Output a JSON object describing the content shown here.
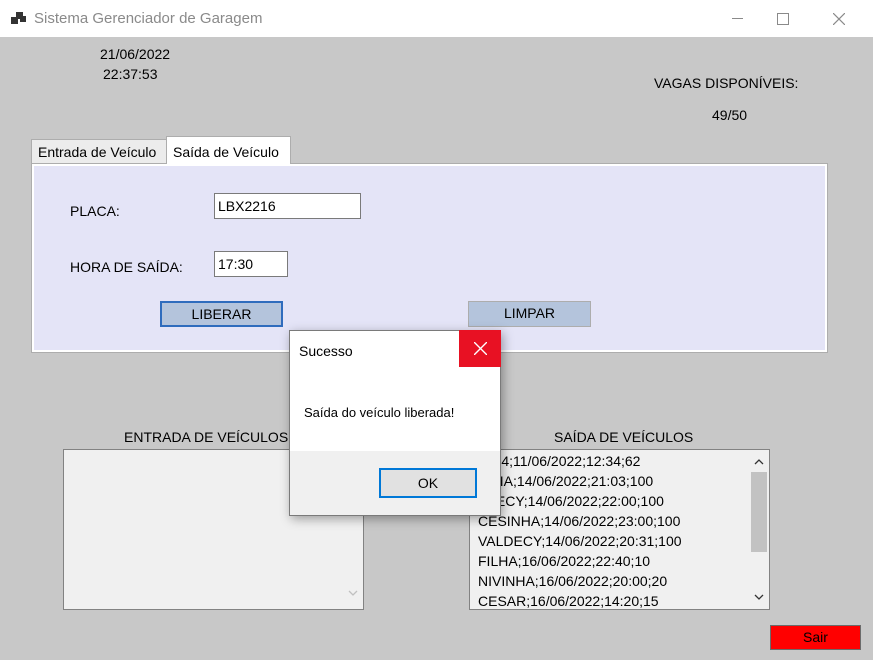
{
  "window": {
    "title": "Sistema Gerenciador de Garagem",
    "minimize_icon": "minimize-icon",
    "maximize_icon": "maximize-icon",
    "close_icon": "close-icon"
  },
  "clock": {
    "date": "21/06/2022",
    "time": "22:37:53"
  },
  "vagas": {
    "label": "VAGAS DISPONÍVEIS:",
    "value": "49/50"
  },
  "tabs": [
    {
      "label": "Entrada de Veículo",
      "selected": false
    },
    {
      "label": "Saída de Veículo",
      "selected": true
    }
  ],
  "form": {
    "placa_label": "PLACA:",
    "placa_value": "LBX2216",
    "hora_label": "HORA DE SAÍDA:",
    "hora_value": "17:30",
    "liberar_label": "LIBERAR",
    "limpar_label": "LIMPAR"
  },
  "entrada_list": {
    "title": "ENTRADA DE VEÍCULOS",
    "items": []
  },
  "saida_list": {
    "title": "SAÍDA DE VEÍCULOS",
    "items": [
      "7154;11/06/2022;12:34;62",
      "CILIA;14/06/2022;21:03;100",
      "LDECY;14/06/2022;22:00;100",
      "CESINHA;14/06/2022;23:00;100",
      "VALDECY;14/06/2022;20:31;100",
      "FILHA;16/06/2022;22:40;10",
      "NIVINHA;16/06/2022;20:00;20",
      "CESAR;16/06/2022;14:20;15"
    ]
  },
  "dialog": {
    "title": "Sucesso",
    "message": "Saída do veículo liberada!",
    "ok_label": "OK"
  },
  "sair_label": "Sair",
  "colors": {
    "sair_button": "#ff0000",
    "dialog_close": "#e81123",
    "panel_bg": "#e4e4f7",
    "button_bg": "#b4c4dc"
  }
}
